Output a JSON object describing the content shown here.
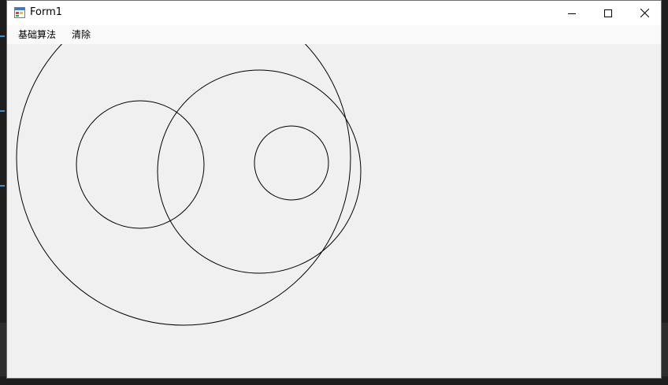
{
  "window": {
    "title": "Form1",
    "controls": {
      "minimize_icon": "minimize-icon",
      "maximize_icon": "maximize-icon",
      "close_icon": "close-icon"
    }
  },
  "menu": {
    "items": [
      {
        "label": "基础算法"
      },
      {
        "label": "清除"
      }
    ]
  },
  "canvas": {
    "stroke_color": "#000000",
    "background": "#f0f0f0"
  }
}
